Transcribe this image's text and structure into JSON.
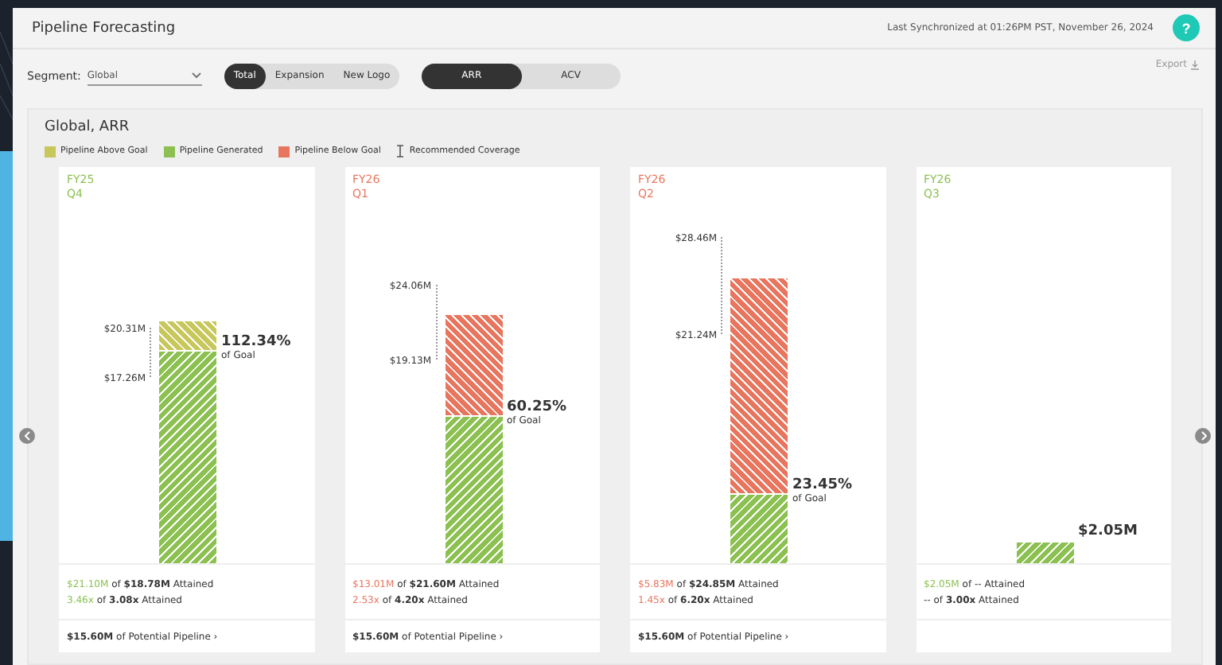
{
  "header": {
    "title": "Pipeline Forecasting",
    "sync": "Last Synchronized at 01:26PM PST, November 26, 2024",
    "help": "?"
  },
  "controls": {
    "segment_label": "Segment:",
    "segment_value": "Global",
    "scope_tabs": [
      {
        "label": "Total",
        "selected": true
      },
      {
        "label": "Expansion",
        "selected": false
      },
      {
        "label": "New Logo",
        "selected": false
      }
    ],
    "metric_tabs": [
      {
        "label": "ARR",
        "selected": true
      },
      {
        "label": "ACV",
        "selected": false
      }
    ],
    "export": "Export"
  },
  "panel": {
    "title": "Global, ARR",
    "legend": [
      {
        "kind": "swatch",
        "label": "Pipeline Above Goal",
        "color": "#c8c75c"
      },
      {
        "kind": "swatch",
        "label": "Pipeline Generated",
        "color": "#8cc152"
      },
      {
        "kind": "swatch",
        "label": "Pipeline Below Goal",
        "color": "#e8765e"
      },
      {
        "kind": "range",
        "label": "Recommended Coverage"
      }
    ],
    "cards": [
      {
        "year": "FY25",
        "quarter": "Q4",
        "color": "#8cc152",
        "segments": [
          {
            "kind": "generated"
          },
          {
            "kind": "above"
          }
        ],
        "coverage": {
          "high": "$20.31M",
          "low": "$17.26M"
        },
        "result": {
          "value": "112.34%",
          "caption": "of Goal"
        },
        "stat_1": {
          "value": "$21.10M",
          "rest": "of **$18.78M** Attained"
        },
        "stat_2": {
          "value": "3.46x",
          "rest": "of **3.08x** Attained"
        },
        "footer": "**$15.60M** of Potential Pipeline ›"
      },
      {
        "year": "FY26",
        "quarter": "Q1",
        "color": "#e8765e",
        "segments": [
          {
            "kind": "generated"
          },
          {
            "kind": "below"
          }
        ],
        "coverage": {
          "high": "$24.06M",
          "low": "$19.13M"
        },
        "result": {
          "value": "60.25%",
          "caption": "of Goal"
        },
        "stat_1": {
          "value": "$13.01M",
          "rest": "of **$21.60M** Attained"
        },
        "stat_2": {
          "value": "2.53x",
          "rest": "of **4.20x** Attained"
        },
        "footer": "**$15.60M** of Potential Pipeline ›"
      },
      {
        "year": "FY26",
        "quarter": "Q2",
        "color": "#e8765e",
        "segments": [
          {
            "kind": "generated"
          },
          {
            "kind": "below"
          }
        ],
        "coverage": {
          "high": "$28.46M",
          "low": "$21.24M"
        },
        "result": {
          "value": "23.45%",
          "caption": "of Goal"
        },
        "stat_1": {
          "value": "$5.83M",
          "rest": "of **$24.85M** Attained"
        },
        "stat_2": {
          "value": "1.45x",
          "rest": "of **6.20x** Attained"
        },
        "footer": "**$15.60M** of Potential Pipeline ›"
      },
      {
        "year": "FY26",
        "quarter": "Q3",
        "color": "#8cc152",
        "segments": [
          {
            "kind": "generated"
          }
        ],
        "result": {
          "value": "$2.05M"
        },
        "stat_1": {
          "value": "$2.05M",
          "rest": "of -- Attained"
        },
        "stat_2": {
          "rest": "-- of **3.00x** Attained"
        }
      }
    ]
  }
}
